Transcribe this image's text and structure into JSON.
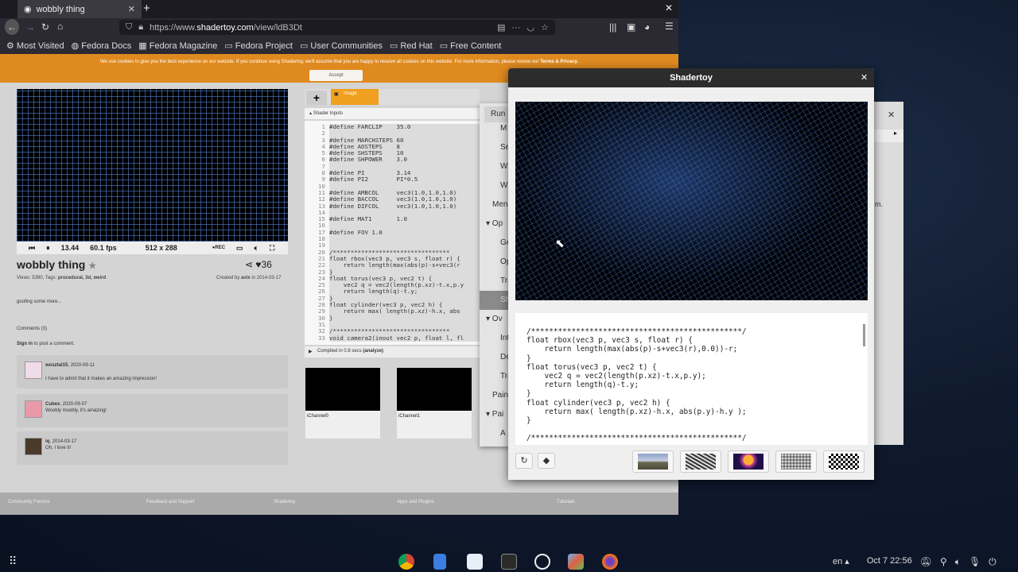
{
  "browser": {
    "tab_title": "wobbly thing",
    "url_prefix": "https://www.",
    "url_domain": "shadertoy.com",
    "url_path": "/view/ldB3Dt",
    "bookmarks": [
      "Most Visited",
      "Fedora Docs",
      "Fedora Magazine",
      "Fedora Project",
      "User Communities",
      "Red Hat",
      "Free Content"
    ]
  },
  "cookie": {
    "text": "We use cookies to give you the best experience on our website. If you continue using Shadertoy, we'll assume that you are happy to receive all cookies on this website. For more information, please review our",
    "link": "Terms & Privacy.",
    "accept": "Accept"
  },
  "player": {
    "time": "13.44",
    "fps": "60.1 fps",
    "resolution": "512 x 288",
    "rec": "REC"
  },
  "shader": {
    "title": "wobbly thing",
    "views": "Views: 5390, Tags:",
    "tags": "procedural, 3d, weird",
    "created_prefix": "Created by",
    "author": "avix",
    "created_suffix": "in 2014-03-17",
    "likes": "36",
    "description": "goofing some more...",
    "comments_header": "Comments (3)",
    "signin": "Sign in",
    "signin_suffix": "to post a comment."
  },
  "comments": [
    {
      "user": "wosztal15",
      "date": ", 2020-09-11",
      "text": "I have to admit that it makes an amazing impression!"
    },
    {
      "user": "Cubex",
      "date": ", 2020-09-07",
      "text": "Woobly moobly, it's amazing!"
    },
    {
      "user": "iq",
      "date": ", 2014-03-17",
      "text": "Oh, I love it!"
    }
  ],
  "editor": {
    "tab": "Image",
    "inputs": "Shader Inputs",
    "compiled": "Compiled in 0.8 secs",
    "analyze": "(analyze)",
    "gutter": "1\n2\n3\n4\n5\n6\n7\n8\n9\n10\n11\n12\n13\n14\n15\n16\n17\n18\n19\n20\n21\n22\n23\n24\n25\n26\n27\n28\n29\n30\n31\n32\n33",
    "code": "#define FARCLIP    35.0\n\n#define MARCHSTEPS 60\n#define AOSTEPS    8\n#define SHSTEPS    10\n#define SHPOWER    3.0\n\n#define PI         3.14\n#define PI2        PI*0.5\n\n#define AMBCOL     vec3(1.0,1.0,1.0)\n#define BACCOL     vec3(1.0,1.0,1.0)\n#define DIFCOL     vec3(1.0,1.0,1.0)\n\n#define MAT1       1.0\n\n#define FOV 1.0\n\n\n/*********************************\nfloat rbox(vec3 p, vec3 s, float r) {\n    return length(max(abs(p)-s+vec3(r\n}\nfloat torus(vec3 p, vec2 t) {\n    vec2 q = vec2(length(p.xz)-t.x,p.y\n    return length(q)-t.y;\n}\nfloat cylinder(vec3 p, vec2 h) {\n    return max( length(p.xz)-h.x, abs\n}\n\n/*********************************\nvoid camera2(inout vec2 p, float l, fl",
    "channels": [
      "iChannel0",
      "iChannel1"
    ]
  },
  "menu": {
    "run": "Run",
    "items": [
      "M",
      "Se",
      "W",
      "W",
      "Men",
      "▾ Op",
      "Ge",
      "Op",
      "Tra",
      "Sh",
      "▾ Ov",
      "Int",
      "De",
      "Tra",
      "Paint",
      "▾ Pai",
      "A"
    ]
  },
  "footer": [
    "Community Forums",
    "Feedback and Support",
    "Shadertoy",
    "Apps and Plugins",
    "Tutorials"
  ],
  "dialog": {
    "title": "Shadertoy",
    "code": "/***********************************************/\nfloat rbox(vec3 p, vec3 s, float r) {\n    return length(max(abs(p)-s+vec3(r),0.0))-r;\n}\nfloat torus(vec3 p, vec2 t) {\n    vec2 q = vec2(length(p.xz)-t.x,p.y);\n    return length(q)-t.y;\n}\nfloat cylinder(vec3 p, vec2 h) {\n    return max( length(p.xz)-h.x, abs(p.y)-h.y );\n}\n\n/***********************************************/"
  },
  "bg_window": {
    "text": "m."
  },
  "tray": {
    "lang": "en",
    "datetime": "Oct 7  22:56"
  }
}
